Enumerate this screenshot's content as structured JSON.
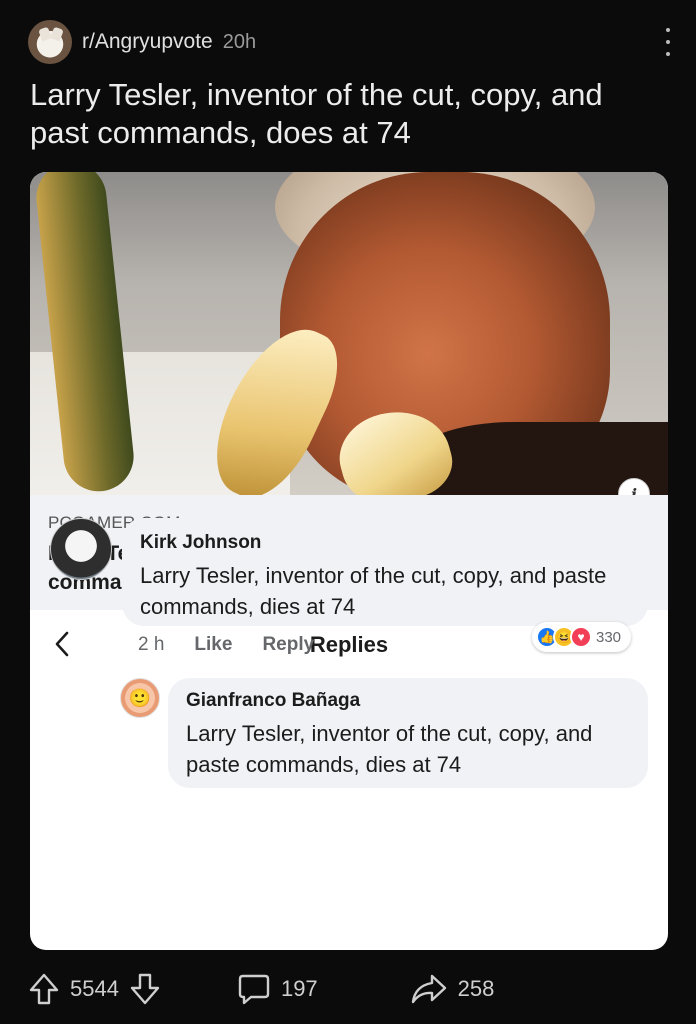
{
  "post": {
    "subreddit": "r/Angryupvote",
    "age": "20h",
    "title": "Larry Tesler, inventor of the cut, copy, and past commands, does at 74"
  },
  "link_preview": {
    "domain": "PCGAMER.COM",
    "title": "Larry Tesler, inventor of the cut, copy, and paste commands, dies at 74"
  },
  "replies_header": {
    "title": "Replies"
  },
  "comment": {
    "author": "Kirk Johnson",
    "text": "Larry Tesler, inventor of the cut, copy, and paste commands, dies at 74",
    "time": "2 h",
    "like_label": "Like",
    "reply_label": "Reply",
    "reaction_count": "330"
  },
  "reply": {
    "author": "Gianfranco Bañaga",
    "text": "Larry Tesler, inventor of the cut, copy, and paste commands, dies at 74"
  },
  "actions": {
    "upvotes": "5544",
    "comments": "197",
    "shares": "258"
  },
  "colors": {
    "background": "#0b0b0b",
    "like_blue": "#1877f2",
    "love_red": "#f33e58",
    "haha_yellow": "#f7c324"
  },
  "icons": [
    "kebab-menu-icon",
    "info-icon",
    "back-chevron-icon",
    "upvote-arrow-icon",
    "downvote-arrow-icon",
    "comment-bubble-icon",
    "share-arrow-icon"
  ]
}
